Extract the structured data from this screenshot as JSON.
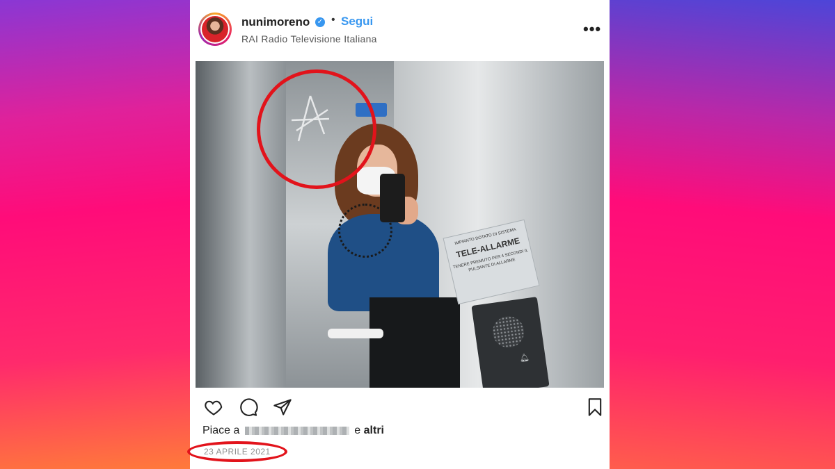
{
  "post": {
    "username": "nunimoreno",
    "verified_badge": "✓",
    "separator": "•",
    "follow_label": "Segui",
    "location": "RAI Radio Televisione Italiana",
    "more_icon": "•••",
    "photo": {
      "sign_top": "IMPIANTO DOTATO DI SISTEMA",
      "sign_main": "TELE-ALLARME",
      "sign_bottom": "TENERE PREMUTO PER 4 SECONDI IL PULSANTE DI ALLARME"
    },
    "likes_prefix": "Piace a",
    "likes_suffix_word": "e",
    "likes_others": "altri",
    "date": "23 APRILE 2021"
  },
  "icons": [
    "heart-icon",
    "comment-icon",
    "share-icon",
    "bookmark-icon"
  ],
  "colors": {
    "accent": "#3897f0",
    "highlight_red": "#e2131b"
  }
}
